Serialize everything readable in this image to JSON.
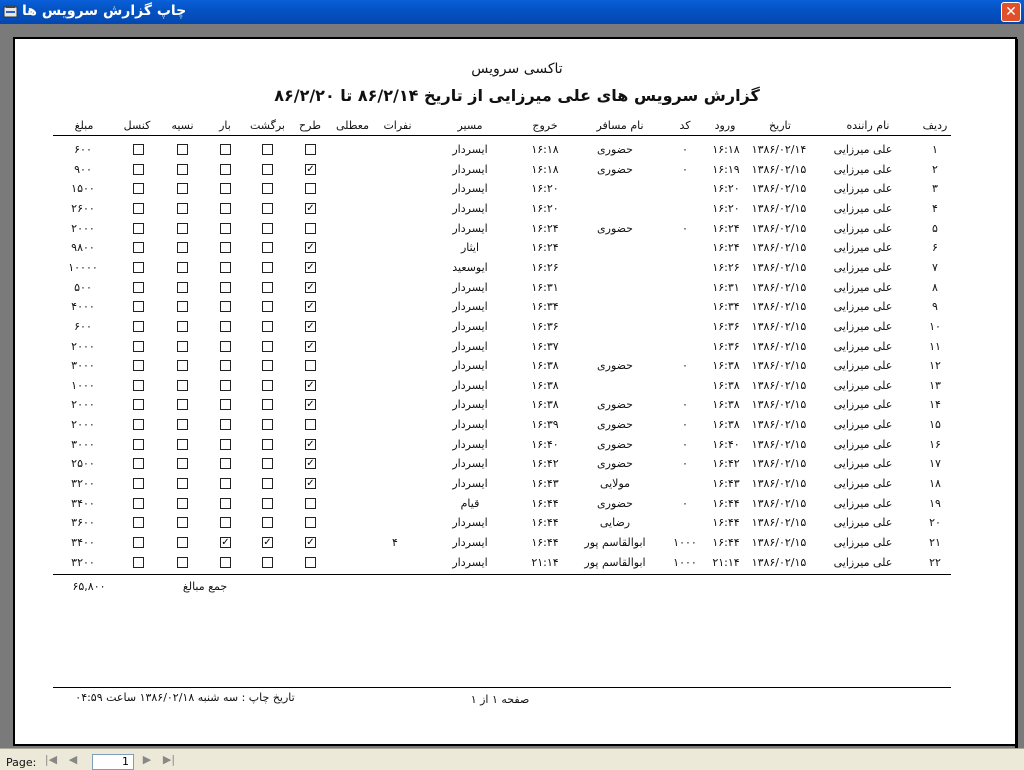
{
  "window": {
    "title": "چاپ گزارش سرویس ها",
    "close_label": "✕"
  },
  "report": {
    "company": "تاکسی سرویس",
    "title": "گزارش سرویس های علی میرزایی از تاریخ ۸۶/۲/۱۴ تا ۸۶/۲/۲۰",
    "columns": {
      "radif": "ردیف",
      "driver": "نام راننده",
      "date": "تاریخ",
      "entry": "ورود",
      "code": "کد",
      "passenger": "نام مسافر",
      "exit": "خروج",
      "route": "مسیر",
      "persons": "نفرات",
      "wait": "معطلی",
      "plan": "طرح",
      "return": "برگشت",
      "cargo": "بار",
      "credit": "نسیه",
      "cancel": "کنسل",
      "amount": "مبلغ"
    },
    "rows": [
      {
        "radif": "۱",
        "driver": "علی میرزایی",
        "date": "۱۳۸۶/۰۲/۱۴",
        "entry": "۱۶:۱۸",
        "code": "۰",
        "passenger": "حضوری",
        "exit": "۱۶:۱۸",
        "route": "ایسردار",
        "persons": "",
        "plan": false,
        "return": false,
        "cargo": false,
        "credit": false,
        "cancel": false,
        "amount": "۶۰۰"
      },
      {
        "radif": "۲",
        "driver": "علی میرزایی",
        "date": "۱۳۸۶/۰۲/۱۵",
        "entry": "۱۶:۱۹",
        "code": "۰",
        "passenger": "حضوری",
        "exit": "۱۶:۱۸",
        "route": "ایسردار",
        "persons": "",
        "plan": true,
        "return": false,
        "cargo": false,
        "credit": false,
        "cancel": false,
        "amount": "۹۰۰"
      },
      {
        "radif": "۳",
        "driver": "علی میرزایی",
        "date": "۱۳۸۶/۰۲/۱۵",
        "entry": "۱۶:۲۰",
        "code": "",
        "passenger": "",
        "exit": "۱۶:۲۰",
        "route": "ایسردار",
        "persons": "",
        "plan": false,
        "return": false,
        "cargo": false,
        "credit": false,
        "cancel": false,
        "amount": "۱۵۰۰"
      },
      {
        "radif": "۴",
        "driver": "علی میرزایی",
        "date": "۱۳۸۶/۰۲/۱۵",
        "entry": "۱۶:۲۰",
        "code": "",
        "passenger": "",
        "exit": "۱۶:۲۰",
        "route": "ایسردار",
        "persons": "",
        "plan": true,
        "return": false,
        "cargo": false,
        "credit": false,
        "cancel": false,
        "amount": "۲۶۰۰"
      },
      {
        "radif": "۵",
        "driver": "علی میرزایی",
        "date": "۱۳۸۶/۰۲/۱۵",
        "entry": "۱۶:۲۴",
        "code": "۰",
        "passenger": "حضوری",
        "exit": "۱۶:۲۴",
        "route": "ایسردار",
        "persons": "",
        "plan": false,
        "return": false,
        "cargo": false,
        "credit": false,
        "cancel": false,
        "amount": "۲۰۰۰"
      },
      {
        "radif": "۶",
        "driver": "علی میرزایی",
        "date": "۱۳۸۶/۰۲/۱۵",
        "entry": "۱۶:۲۴",
        "code": "",
        "passenger": "",
        "exit": "۱۶:۲۴",
        "route": "ایثار",
        "persons": "",
        "plan": true,
        "return": false,
        "cargo": false,
        "credit": false,
        "cancel": false,
        "amount": "۹۸۰۰"
      },
      {
        "radif": "۷",
        "driver": "علی میرزایی",
        "date": "۱۳۸۶/۰۲/۱۵",
        "entry": "۱۶:۲۶",
        "code": "",
        "passenger": "",
        "exit": "۱۶:۲۶",
        "route": "ایوسعید",
        "persons": "",
        "plan": true,
        "return": false,
        "cargo": false,
        "credit": false,
        "cancel": false,
        "amount": "۱۰۰۰۰"
      },
      {
        "radif": "۸",
        "driver": "علی میرزایی",
        "date": "۱۳۸۶/۰۲/۱۵",
        "entry": "۱۶:۳۱",
        "code": "",
        "passenger": "",
        "exit": "۱۶:۳۱",
        "route": "ایسردار",
        "persons": "",
        "plan": true,
        "return": false,
        "cargo": false,
        "credit": false,
        "cancel": false,
        "amount": "۵۰۰"
      },
      {
        "radif": "۹",
        "driver": "علی میرزایی",
        "date": "۱۳۸۶/۰۲/۱۵",
        "entry": "۱۶:۳۴",
        "code": "",
        "passenger": "",
        "exit": "۱۶:۳۴",
        "route": "ایسردار",
        "persons": "",
        "plan": true,
        "return": false,
        "cargo": false,
        "credit": false,
        "cancel": false,
        "amount": "۴۰۰۰"
      },
      {
        "radif": "۱۰",
        "driver": "علی میرزایی",
        "date": "۱۳۸۶/۰۲/۱۵",
        "entry": "۱۶:۳۶",
        "code": "",
        "passenger": "",
        "exit": "۱۶:۳۶",
        "route": "ایسردار",
        "persons": "",
        "plan": true,
        "return": false,
        "cargo": false,
        "credit": false,
        "cancel": false,
        "amount": "۶۰۰"
      },
      {
        "radif": "۱۱",
        "driver": "علی میرزایی",
        "date": "۱۳۸۶/۰۲/۱۵",
        "entry": "۱۶:۳۶",
        "code": "",
        "passenger": "",
        "exit": "۱۶:۳۷",
        "route": "ایسردار",
        "persons": "",
        "plan": true,
        "return": false,
        "cargo": false,
        "credit": false,
        "cancel": false,
        "amount": "۲۰۰۰"
      },
      {
        "radif": "۱۲",
        "driver": "علی میرزایی",
        "date": "۱۳۸۶/۰۲/۱۵",
        "entry": "۱۶:۳۸",
        "code": "۰",
        "passenger": "حضوری",
        "exit": "۱۶:۳۸",
        "route": "ایسردار",
        "persons": "",
        "plan": false,
        "return": false,
        "cargo": false,
        "credit": false,
        "cancel": false,
        "amount": "۳۰۰۰"
      },
      {
        "radif": "۱۳",
        "driver": "علی میرزایی",
        "date": "۱۳۸۶/۰۲/۱۵",
        "entry": "۱۶:۳۸",
        "code": "",
        "passenger": "",
        "exit": "۱۶:۳۸",
        "route": "ایسردار",
        "persons": "",
        "plan": true,
        "return": false,
        "cargo": false,
        "credit": false,
        "cancel": false,
        "amount": "۱۰۰۰"
      },
      {
        "radif": "۱۴",
        "driver": "علی میرزایی",
        "date": "۱۳۸۶/۰۲/۱۵",
        "entry": "۱۶:۳۸",
        "code": "۰",
        "passenger": "حضوری",
        "exit": "۱۶:۳۸",
        "route": "ایسردار",
        "persons": "",
        "plan": true,
        "return": false,
        "cargo": false,
        "credit": false,
        "cancel": false,
        "amount": "۲۰۰۰"
      },
      {
        "radif": "۱۵",
        "driver": "علی میرزایی",
        "date": "۱۳۸۶/۰۲/۱۵",
        "entry": "۱۶:۳۸",
        "code": "۰",
        "passenger": "حضوری",
        "exit": "۱۶:۳۹",
        "route": "ایسردار",
        "persons": "",
        "plan": false,
        "return": false,
        "cargo": false,
        "credit": false,
        "cancel": false,
        "amount": "۲۰۰۰"
      },
      {
        "radif": "۱۶",
        "driver": "علی میرزایی",
        "date": "۱۳۸۶/۰۲/۱۵",
        "entry": "۱۶:۴۰",
        "code": "۰",
        "passenger": "حضوری",
        "exit": "۱۶:۴۰",
        "route": "ایسردار",
        "persons": "",
        "plan": true,
        "return": false,
        "cargo": false,
        "credit": false,
        "cancel": false,
        "amount": "۳۰۰۰"
      },
      {
        "radif": "۱۷",
        "driver": "علی میرزایی",
        "date": "۱۳۸۶/۰۲/۱۵",
        "entry": "۱۶:۴۲",
        "code": "۰",
        "passenger": "حضوری",
        "exit": "۱۶:۴۲",
        "route": "ایسردار",
        "persons": "",
        "plan": true,
        "return": false,
        "cargo": false,
        "credit": false,
        "cancel": false,
        "amount": "۲۵۰۰"
      },
      {
        "radif": "۱۸",
        "driver": "علی میرزایی",
        "date": "۱۳۸۶/۰۲/۱۵",
        "entry": "۱۶:۴۳",
        "code": "",
        "passenger": "مولایی",
        "exit": "۱۶:۴۳",
        "route": "ایسردار",
        "persons": "",
        "plan": true,
        "return": false,
        "cargo": false,
        "credit": false,
        "cancel": false,
        "amount": "۳۲۰۰"
      },
      {
        "radif": "۱۹",
        "driver": "علی میرزایی",
        "date": "۱۳۸۶/۰۲/۱۵",
        "entry": "۱۶:۴۴",
        "code": "۰",
        "passenger": "حضوری",
        "exit": "۱۶:۴۴",
        "route": "قیام",
        "persons": "",
        "plan": false,
        "return": false,
        "cargo": false,
        "credit": false,
        "cancel": false,
        "amount": "۳۴۰۰"
      },
      {
        "radif": "۲۰",
        "driver": "علی میرزایی",
        "date": "۱۳۸۶/۰۲/۱۵",
        "entry": "۱۶:۴۴",
        "code": "",
        "passenger": "رضایی",
        "exit": "۱۶:۴۴",
        "route": "ایسردار",
        "persons": "",
        "plan": false,
        "return": false,
        "cargo": false,
        "credit": false,
        "cancel": false,
        "amount": "۳۶۰۰"
      },
      {
        "radif": "۲۱",
        "driver": "علی میرزایی",
        "date": "۱۳۸۶/۰۲/۱۵",
        "entry": "۱۶:۴۴",
        "code": "۱۰۰۰",
        "passenger": "ابوالقاسم پور",
        "exit": "۱۶:۴۴",
        "route": "ایسردار",
        "persons": "۴",
        "plan": true,
        "return": true,
        "cargo": true,
        "credit": false,
        "cancel": false,
        "amount": "۳۴۰۰"
      },
      {
        "radif": "۲۲",
        "driver": "علی میرزایی",
        "date": "۱۳۸۶/۰۲/۱۵",
        "entry": "۲۱:۱۴",
        "code": "۱۰۰۰",
        "passenger": "ابوالقاسم پور",
        "exit": "۲۱:۱۴",
        "route": "ایسردار",
        "persons": "",
        "plan": false,
        "return": false,
        "cargo": false,
        "credit": false,
        "cancel": false,
        "amount": "۳۲۰۰"
      }
    ],
    "total_label": "جمع مبالغ",
    "total_value": "۶۵,۸۰۰",
    "footer": {
      "page_text": "صفحه ۱ از ۱",
      "print_date": "تاریخ چاپ  : سه شنبه  ۱۳۸۶/۰۲/۱۸   ساعت ۰۴:۵۹"
    }
  },
  "navigation": {
    "page_label": "Page:",
    "page_value": "1",
    "first": "|◀",
    "prev": "◀",
    "next": "▶",
    "last": "▶|"
  }
}
